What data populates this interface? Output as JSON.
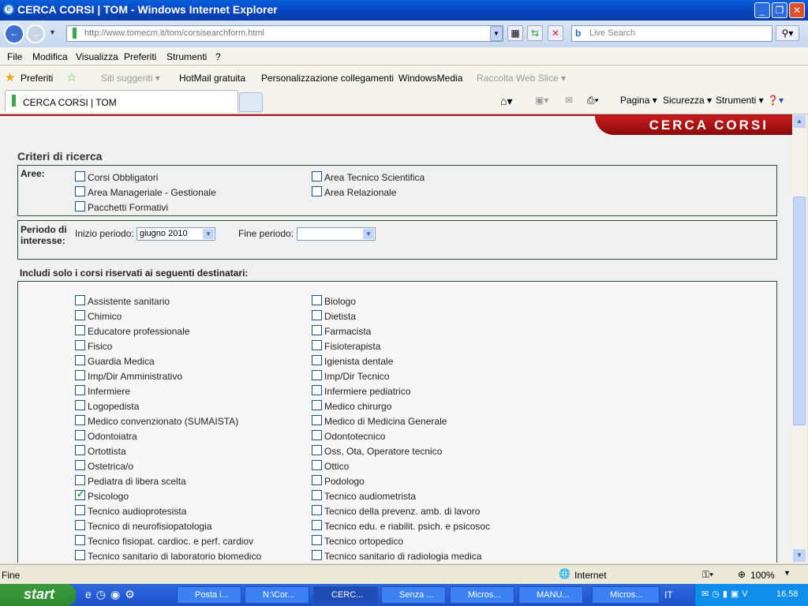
{
  "window": {
    "title": "CERCA CORSI | TOM - Windows Internet Explorer"
  },
  "address": {
    "url": "http://www.tomecm.it/tom/corsisearchform.html",
    "search_placeholder": "Live Search"
  },
  "menu": [
    "File",
    "Modifica",
    "Visualizza",
    "Preferiti",
    "Strumenti",
    "?"
  ],
  "favorites": {
    "label": "Preferiti",
    "links": [
      "Siti suggeriti ▾",
      "HotMail gratuita",
      "Personalizzazione collegamenti",
      "WindowsMedia",
      "Raccolta Web Slice ▾"
    ]
  },
  "tab": {
    "label": "CERCA CORSI | TOM"
  },
  "commands": [
    "Pagina ▾",
    "Sicurezza ▾",
    "Strumenti ▾"
  ],
  "page": {
    "banner": "CERCA CORSI",
    "heading": "Criteri di ricerca",
    "aree_label": "Aree:",
    "aree": [
      {
        "label": "Corsi Obbligatori",
        "checked": false
      },
      {
        "label": "Area Tecnico Scientifica",
        "checked": false
      },
      {
        "label": "Area Manageriale - Gestionale",
        "checked": false
      },
      {
        "label": "Area Relazionale",
        "checked": false
      },
      {
        "label": "Pacchetti Formativi",
        "checked": false
      }
    ],
    "periodo_label": "Periodo di interesse:",
    "inizio_label": "Inizio periodo:",
    "inizio_value": "giugno 2010",
    "fine_label": "Fine periodo:",
    "fine_value": "",
    "destinatari_label": "Includi solo i corsi riservati ai seguenti destinatari:",
    "destinatari": [
      {
        "label": "Assistente sanitario",
        "checked": false
      },
      {
        "label": "Biologo",
        "checked": false
      },
      {
        "label": "Chimico",
        "checked": false
      },
      {
        "label": "Dietista",
        "checked": false
      },
      {
        "label": "Educatore professionale",
        "checked": false
      },
      {
        "label": "Farmacista",
        "checked": false
      },
      {
        "label": "Fisico",
        "checked": false
      },
      {
        "label": "Fisioterapista",
        "checked": false
      },
      {
        "label": "Guardia Medica",
        "checked": false
      },
      {
        "label": "Igienista dentale",
        "checked": false
      },
      {
        "label": "Imp/Dir Amministrativo",
        "checked": false
      },
      {
        "label": "Imp/Dir Tecnico",
        "checked": false
      },
      {
        "label": "Infermiere",
        "checked": false
      },
      {
        "label": "Infermiere pediatrico",
        "checked": false
      },
      {
        "label": "Logopedista",
        "checked": false
      },
      {
        "label": "Medico chirurgo",
        "checked": false
      },
      {
        "label": "Medico convenzionato (SUMAISTA)",
        "checked": false
      },
      {
        "label": "Medico di Medicina Generale",
        "checked": false
      },
      {
        "label": "Odontoiatra",
        "checked": false
      },
      {
        "label": "Odontotecnico",
        "checked": false
      },
      {
        "label": "Ortottista",
        "checked": false
      },
      {
        "label": "Oss, Ota, Operatore tecnico",
        "checked": false
      },
      {
        "label": "Ostetrica/o",
        "checked": false
      },
      {
        "label": "Ottico",
        "checked": false
      },
      {
        "label": "Pediatra di libera scelta",
        "checked": false
      },
      {
        "label": "Podologo",
        "checked": false
      },
      {
        "label": "Psicologo",
        "checked": true
      },
      {
        "label": "Tecnico audiometrista",
        "checked": false
      },
      {
        "label": "Tecnico audioprotesista",
        "checked": false
      },
      {
        "label": "Tecnico della prevenz. amb. di lavoro",
        "checked": false
      },
      {
        "label": "Tecnico di neurofisiopatologia",
        "checked": false
      },
      {
        "label": "Tecnico edu. e riabilit. psich. e psicosoc",
        "checked": false
      },
      {
        "label": "Tecnico fisiopat. cardioc. e perf. cardiov",
        "checked": false
      },
      {
        "label": "Tecnico ortopedico",
        "checked": false
      },
      {
        "label": "Tecnico sanitario di laboratorio biomedico",
        "checked": false
      },
      {
        "label": "Tecnico sanitario di radiologia medica",
        "checked": false
      }
    ]
  },
  "status": {
    "text": "Fine",
    "zone": "Internet",
    "zoom": "100%"
  },
  "taskbar": {
    "start": "start",
    "tasks": [
      "Posta i...",
      "N:\\Cor...",
      "CERC...",
      "Senza ...",
      "Micros...",
      "MANU...",
      "Micros..."
    ],
    "lang": "IT",
    "clock": "16.58"
  }
}
